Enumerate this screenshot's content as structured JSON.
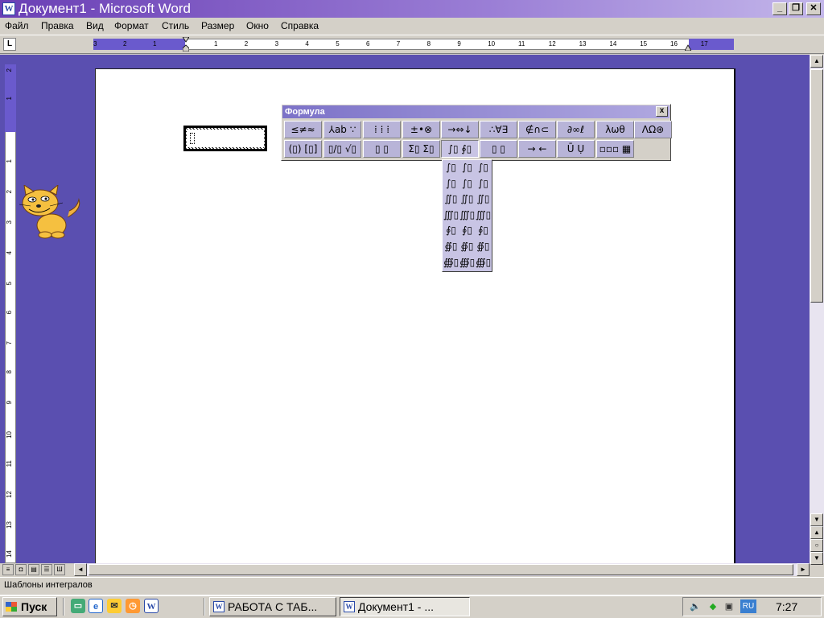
{
  "window": {
    "title": "Документ1 - Microsoft Word",
    "app_icon": "word-icon",
    "app_icon_letter": "W",
    "controls": {
      "minimize": "_",
      "restore": "❐",
      "close": "✕"
    }
  },
  "menu": [
    "Файл",
    "Правка",
    "Вид",
    "Формат",
    "Стиль",
    "Размер",
    "Окно",
    "Справка"
  ],
  "ruler": {
    "corner_label": "L",
    "left_numbers": [
      "3",
      "2",
      "1"
    ],
    "right_numbers": [
      "1",
      "2",
      "3",
      "4",
      "5",
      "6",
      "7",
      "8",
      "9",
      "10",
      "11",
      "12",
      "13",
      "14",
      "15",
      "16",
      "17"
    ],
    "vertical_numbers": [
      "2",
      "1",
      "1",
      "2",
      "3",
      "4",
      "5",
      "6",
      "7",
      "8",
      "9",
      "10",
      "11",
      "12",
      "13",
      "14"
    ]
  },
  "formula_toolbar": {
    "title": "Формула",
    "close": "x",
    "row1": [
      "≤≠≈",
      "⅄ab ∵",
      "⁞ ⁞ ⁞",
      "±•⊗",
      "→⇔↓",
      "∴∀∃",
      "∉∩⊂",
      "∂∞ℓ",
      "λωθ",
      "ΛΩ⊛"
    ],
    "row2": [
      "(▯) [▯]",
      "▯/▯ √▯",
      "▯ ▯",
      "Σ▯ Σ▯",
      "∫▯ ∮▯",
      "▯ ▯",
      "→ ←",
      "Ū Ụ",
      "▫▫▫ ▦"
    ],
    "integral_palette": [
      [
        "∫▯",
        "∫▯",
        "∫▯"
      ],
      [
        "∫▯",
        "∫▯",
        "∫▯"
      ],
      [
        "∬▯",
        "∬▯",
        "∬▯"
      ],
      [
        "∭▯",
        "∭▯",
        "∭▯"
      ],
      [
        "∮▯",
        "∮▯",
        "∮▯"
      ],
      [
        "∯▯",
        "∯▯",
        "∯▯"
      ],
      [
        "∰▯",
        "∰▯",
        "∰▯"
      ]
    ]
  },
  "status": {
    "text": "Шаблоны интегралов"
  },
  "taskbar": {
    "start": "Пуск",
    "quick_launch": [
      "desktop-icon",
      "ie-icon",
      "outlook-icon",
      "clock-app-icon",
      "word-icon"
    ],
    "tasks": [
      {
        "label": "РАБОТА С ТАБ...",
        "active": false
      },
      {
        "label": "Документ1 - ...",
        "active": true
      }
    ],
    "tray": {
      "lang": "RU",
      "clock": "7:27"
    }
  },
  "colors": {
    "workspace": "#5a4fb0",
    "title_gradient_start": "#6a3fb5",
    "toolbar_button": "#b8b4d8"
  }
}
